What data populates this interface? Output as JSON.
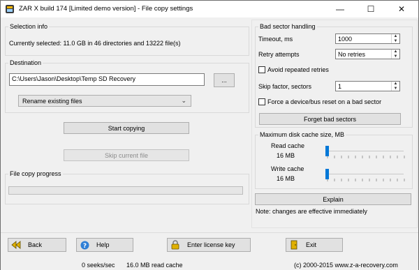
{
  "window": {
    "title": "ZAR X build 174 [Limited demo version] - File copy settings",
    "minimize": "—",
    "maximize": "☐",
    "close": "✕"
  },
  "selection": {
    "label": "Selection info",
    "text": "Currently selected: 11.0 GB in 46 directories and 13222 file(s)"
  },
  "destination": {
    "label": "Destination",
    "path": "C:\\Users\\Jason\\Desktop\\Temp SD Recovery",
    "browse": "...",
    "mode": "Rename existing files"
  },
  "actions": {
    "start": "Start copying",
    "skip": "Skip current file"
  },
  "progress": {
    "label": "File copy progress",
    "value": 0
  },
  "bad_sector": {
    "label": "Bad sector handling",
    "timeout_label": "Timeout, ms",
    "timeout_value": "1000",
    "retry_label": "Retry attempts",
    "retry_value": "No retries",
    "avoid_label": "Avoid repeated retries",
    "avoid_checked": false,
    "skip_label": "Skip factor, sectors",
    "skip_value": "1",
    "reset_label": "Force a device/bus reset on a bad sector",
    "reset_checked": false,
    "forget": "Forget bad sectors"
  },
  "cache": {
    "label": "Maximum disk cache size, MB",
    "read_label": "Read cache",
    "read_value": "16 MB",
    "write_label": "Write cache",
    "write_value": "16 MB",
    "explain": "Explain",
    "note": "Note: changes are effective immediately"
  },
  "buttons": {
    "back": "Back",
    "help": "Help",
    "license": "Enter license key",
    "exit": "Exit"
  },
  "status": {
    "seeks": "0 seeks/sec",
    "cache": "16.0 MB read cache",
    "copyright": "(c) 2000-2015 www.z-a-recovery.com"
  },
  "icons": {
    "app": "zar-app-icon",
    "back": "back-arrows-icon",
    "help": "help-icon",
    "license": "padlock-icon",
    "exit": "exit-icon"
  }
}
